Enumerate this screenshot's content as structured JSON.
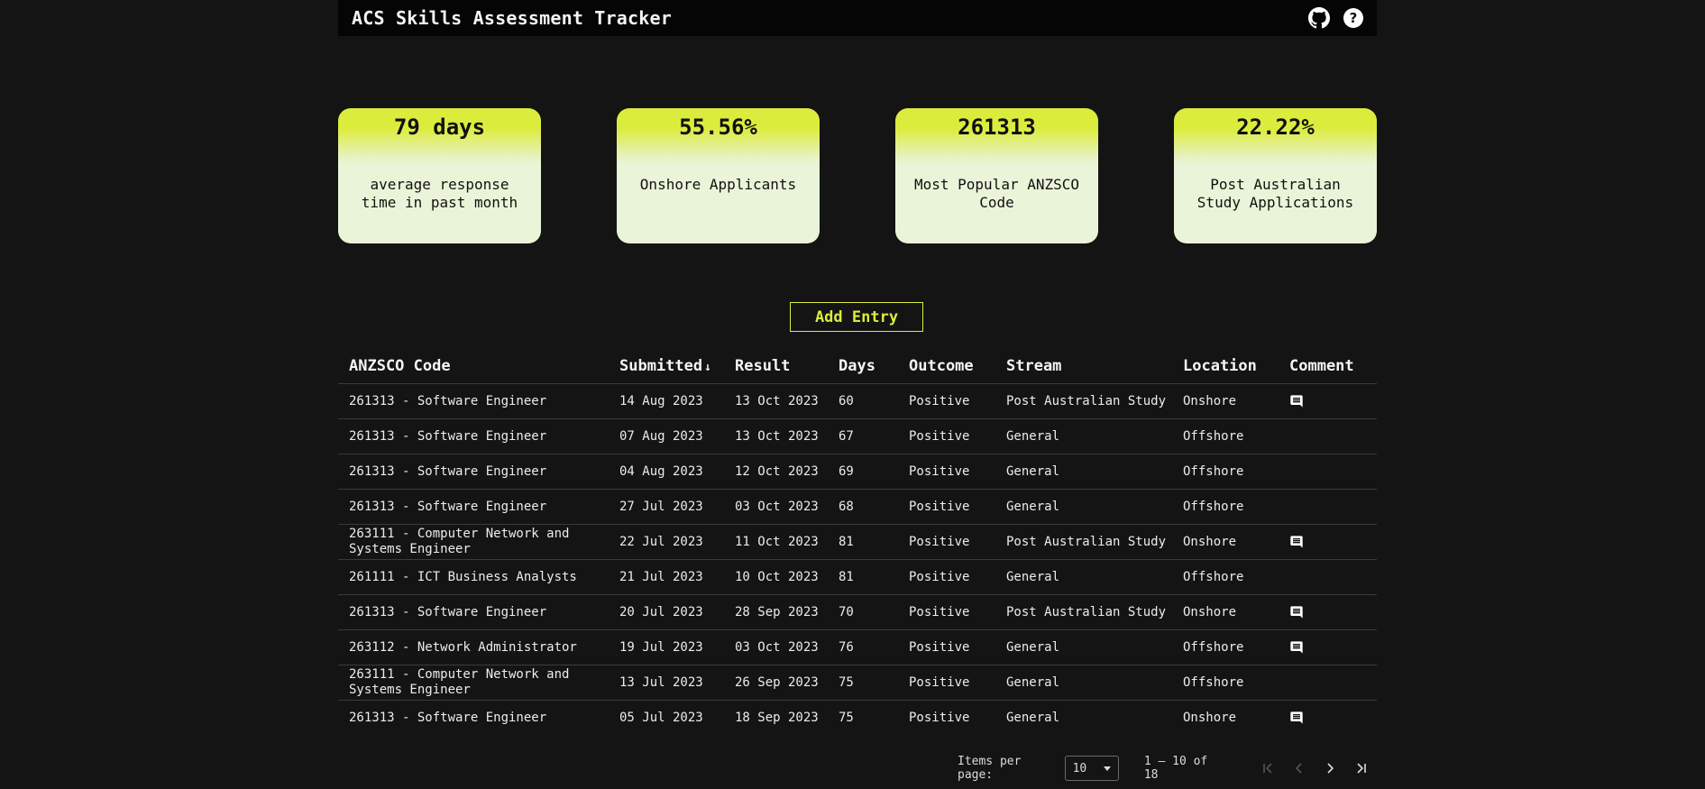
{
  "header": {
    "title": "ACS Skills Assessment Tracker",
    "github_icon": "github-icon",
    "help_label": "?"
  },
  "stats": [
    {
      "value": "79 days",
      "label": "average response time in past month"
    },
    {
      "value": "55.56%",
      "label": "Onshore Applicants"
    },
    {
      "value": "261313",
      "label": "Most Popular ANZSCO Code"
    },
    {
      "value": "22.22%",
      "label": "Post Australian Study Applications"
    }
  ],
  "add_entry_label": "Add Entry",
  "table": {
    "columns": [
      "ANZSCO Code",
      "Submitted",
      "Result",
      "Days",
      "Outcome",
      "Stream",
      "Location",
      "Comment"
    ],
    "sort_indicator": "↓",
    "rows": [
      {
        "code": "261313 - Software Engineer",
        "submitted": "14 Aug 2023",
        "result": "13 Oct 2023",
        "days": "60",
        "outcome": "Positive",
        "stream": "Post Australian Study",
        "location": "Onshore",
        "comment": true
      },
      {
        "code": "261313 - Software Engineer",
        "submitted": "07 Aug 2023",
        "result": "13 Oct 2023",
        "days": "67",
        "outcome": "Positive",
        "stream": "General",
        "location": "Offshore",
        "comment": false
      },
      {
        "code": "261313 - Software Engineer",
        "submitted": "04 Aug 2023",
        "result": "12 Oct 2023",
        "days": "69",
        "outcome": "Positive",
        "stream": "General",
        "location": "Offshore",
        "comment": false
      },
      {
        "code": "261313 - Software Engineer",
        "submitted": "27 Jul 2023",
        "result": "03 Oct 2023",
        "days": "68",
        "outcome": "Positive",
        "stream": "General",
        "location": "Offshore",
        "comment": false
      },
      {
        "code": "263111 - Computer Network and Systems Engineer",
        "submitted": "22 Jul 2023",
        "result": "11 Oct 2023",
        "days": "81",
        "outcome": "Positive",
        "stream": "Post Australian Study",
        "location": "Onshore",
        "comment": true
      },
      {
        "code": "261111 - ICT Business Analysts",
        "submitted": "21 Jul 2023",
        "result": "10 Oct 2023",
        "days": "81",
        "outcome": "Positive",
        "stream": "General",
        "location": "Offshore",
        "comment": false
      },
      {
        "code": "261313 - Software Engineer",
        "submitted": "20 Jul 2023",
        "result": "28 Sep 2023",
        "days": "70",
        "outcome": "Positive",
        "stream": "Post Australian Study",
        "location": "Onshore",
        "comment": true
      },
      {
        "code": "263112 - Network Administrator",
        "submitted": "19 Jul 2023",
        "result": "03 Oct 2023",
        "days": "76",
        "outcome": "Positive",
        "stream": "General",
        "location": "Offshore",
        "comment": true
      },
      {
        "code": "263111 - Computer Network and Systems Engineer",
        "submitted": "13 Jul 2023",
        "result": "26 Sep 2023",
        "days": "75",
        "outcome": "Positive",
        "stream": "General",
        "location": "Offshore",
        "comment": false
      },
      {
        "code": "261313 - Software Engineer",
        "submitted": "05 Jul 2023",
        "result": "18 Sep 2023",
        "days": "75",
        "outcome": "Positive",
        "stream": "General",
        "location": "Onshore",
        "comment": true
      }
    ]
  },
  "paginator": {
    "items_per_page_label": "Items per page:",
    "items_per_page_value": "10",
    "range_label": "1 – 10 of 18"
  },
  "colors": {
    "accent": "#dcec3c",
    "card_bg": "#eaf4d8",
    "background": "#141414",
    "topbar": "#050505"
  }
}
